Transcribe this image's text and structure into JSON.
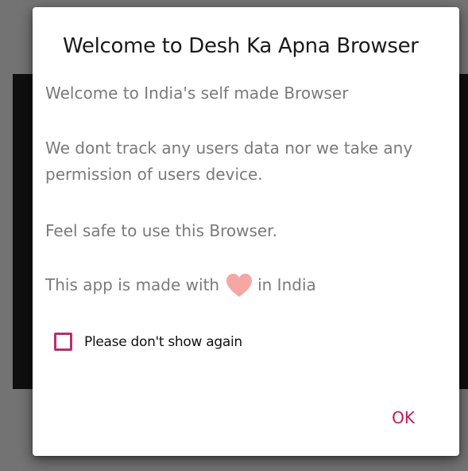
{
  "dialog": {
    "title": "Welcome to Desh Ka Apna Browser",
    "message_line1": "Welcome to India's self made Browser",
    "message_line2": "We dont track any users data nor we take any permission of users device.",
    "message_line3": "Feel safe to use this Browser.",
    "message_line4_prefix": "This app is made with",
    "message_line4_suffix": "in India",
    "heart_icon": "heart-icon",
    "checkbox_label": "Please don't show again",
    "checkbox_checked": false,
    "ok_label": "OK"
  },
  "colors": {
    "accent": "#c2185b",
    "checkbox_border": "#b5316b",
    "heart": "#f4a7a3",
    "message_text": "#7a7a7a",
    "title_text": "#1a1a1a"
  }
}
